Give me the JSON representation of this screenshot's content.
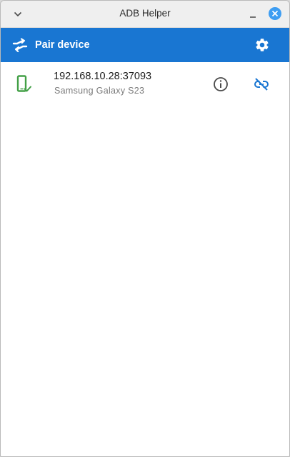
{
  "window": {
    "title": "ADB Helper"
  },
  "appbar": {
    "pair_label": "Pair device",
    "color": "#1976d2"
  },
  "devices": [
    {
      "address": "192.168.10.28:37093",
      "name": "Samsung Galaxy S23",
      "status_color": "#43a047"
    }
  ],
  "icons": {
    "menu": "chevron-down-icon",
    "minimize": "minimize-icon",
    "close": "close-icon",
    "pair": "pair-arrows-icon",
    "settings": "gear-icon",
    "device": "phone-connected-icon",
    "info": "info-icon",
    "disconnect": "link-off-icon"
  }
}
